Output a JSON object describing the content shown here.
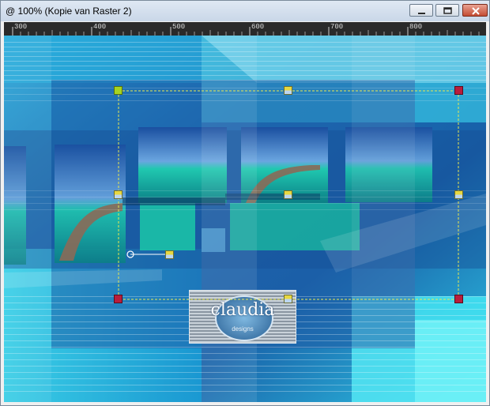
{
  "window": {
    "title": "@ 100% (Kopie van Raster 2)",
    "controls": {
      "minimize": "minimize",
      "maximize": "maximize",
      "close": "close"
    }
  },
  "ruler": {
    "labels": [
      "300",
      "400",
      "500",
      "600",
      "700",
      "800"
    ]
  },
  "watermark": {
    "text": "claudia",
    "subtext": "designs"
  },
  "colors": {
    "canvas_bg": "#1a72b8",
    "accent": "#28c8e0",
    "selection": "#e8e850",
    "handle_corner": "#b81e3c"
  },
  "icons": {
    "minimize": "minimize-icon",
    "maximize": "maximize-icon",
    "close": "close-icon",
    "rotate": "rotate-handle-icon"
  }
}
